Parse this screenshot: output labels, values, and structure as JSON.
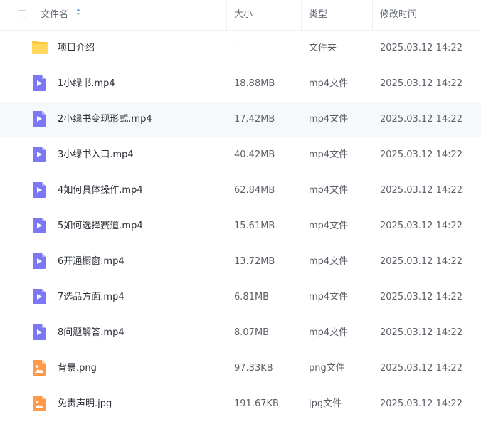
{
  "header": {
    "name": "文件名",
    "size": "大小",
    "type": "类型",
    "modified": "修改时间"
  },
  "rows": [
    {
      "icon": "folder-icon",
      "name": "项目介绍",
      "size": "-",
      "type": "文件夹",
      "modified": "2025.03.12 14:22"
    },
    {
      "icon": "video-file-icon",
      "name": "1小绿书.mp4",
      "size": "18.88MB",
      "type": "mp4文件",
      "modified": "2025.03.12 14:22"
    },
    {
      "icon": "video-file-icon",
      "name": "2小绿书变现形式.mp4",
      "size": "17.42MB",
      "type": "mp4文件",
      "modified": "2025.03.12 14:22"
    },
    {
      "icon": "video-file-icon",
      "name": "3小绿书入口.mp4",
      "size": "40.42MB",
      "type": "mp4文件",
      "modified": "2025.03.12 14:22"
    },
    {
      "icon": "video-file-icon",
      "name": "4如何具体操作.mp4",
      "size": "62.84MB",
      "type": "mp4文件",
      "modified": "2025.03.12 14:22"
    },
    {
      "icon": "video-file-icon",
      "name": "5如何选择赛道.mp4",
      "size": "15.61MB",
      "type": "mp4文件",
      "modified": "2025.03.12 14:22"
    },
    {
      "icon": "video-file-icon",
      "name": "6开通橱窗.mp4",
      "size": "13.72MB",
      "type": "mp4文件",
      "modified": "2025.03.12 14:22"
    },
    {
      "icon": "video-file-icon",
      "name": "7选品方面.mp4",
      "size": "6.81MB",
      "type": "mp4文件",
      "modified": "2025.03.12 14:22"
    },
    {
      "icon": "video-file-icon",
      "name": "8问题解答.mp4",
      "size": "8.07MB",
      "type": "mp4文件",
      "modified": "2025.03.12 14:22"
    },
    {
      "icon": "image-file-icon",
      "name": "背景.png",
      "size": "97.33KB",
      "type": "png文件",
      "modified": "2025.03.12 14:22"
    },
    {
      "icon": "image-file-icon",
      "name": "免责声明.jpg",
      "size": "191.67KB",
      "type": "jpg文件",
      "modified": "2025.03.12 14:22"
    }
  ],
  "highlighted_row": 2,
  "colors": {
    "folder": "#fcc93a",
    "video": "#7c78f5",
    "image": "#ff9a4a",
    "row_highlight": "#f7f8fb",
    "sort_accent": "#4f8dff"
  }
}
